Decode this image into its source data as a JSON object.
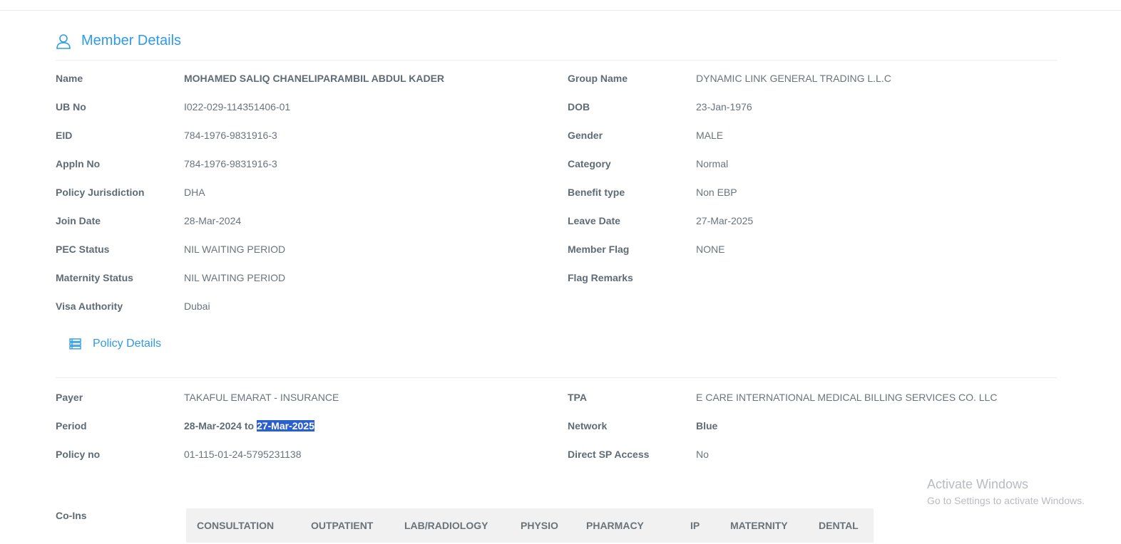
{
  "member": {
    "title": "Member Details",
    "left": [
      {
        "label": "Name",
        "value": "MOHAMED SALIQ CHANELIPARAMBIL ABDUL KADER",
        "bold": true
      },
      {
        "label": "UB No",
        "value": "I022-029-114351406-01"
      },
      {
        "label": "EID",
        "value": "784-1976-9831916-3"
      },
      {
        "label": "Appln No",
        "value": "784-1976-9831916-3"
      },
      {
        "label": "Policy Jurisdiction",
        "value": "DHA"
      },
      {
        "label": "Join Date",
        "value": "28-Mar-2024"
      },
      {
        "label": "PEC Status",
        "value": "NIL WAITING PERIOD"
      },
      {
        "label": "Maternity Status",
        "value": "NIL WAITING PERIOD"
      },
      {
        "label": "Visa Authority",
        "value": "Dubai"
      }
    ],
    "right": [
      {
        "label": "Group Name",
        "value": "DYNAMIC LINK GENERAL TRADING L.L.C"
      },
      {
        "label": "DOB",
        "value": "23-Jan-1976"
      },
      {
        "label": "Gender",
        "value": "MALE"
      },
      {
        "label": "Category",
        "value": "Normal"
      },
      {
        "label": "Benefit type",
        "value": "Non EBP"
      },
      {
        "label": "Leave Date",
        "value": "27-Mar-2025"
      },
      {
        "label": "Member Flag",
        "value": "NONE"
      },
      {
        "label": "Flag Remarks",
        "value": ""
      }
    ]
  },
  "policy": {
    "title": "Policy Details",
    "payer_label": "Payer",
    "payer": "TAKAFUL EMARAT - INSURANCE",
    "period_label": "Period",
    "period_from": "28-Mar-2024",
    "period_to_word": "to",
    "period_to": "27-Mar-2025",
    "policy_no_label": "Policy no",
    "policy_no": "01-115-01-24-5795231138",
    "tpa_label": "TPA",
    "tpa": "E CARE INTERNATIONAL MEDICAL BILLING SERVICES CO. LLC",
    "network_label": "Network",
    "network": "Blue",
    "direct_label": "Direct SP Access",
    "direct": "No"
  },
  "coins": {
    "label": "Co-Ins",
    "columns": [
      "CONSULTATION",
      "OUTPATIENT",
      "LAB/RADIOLOGY",
      "PHYSIO",
      "PHARMACY",
      "IP",
      "MATERNITY",
      "DENTAL"
    ]
  },
  "watermark": {
    "line1": "Activate Windows",
    "line2": "Go to Settings to activate Windows."
  },
  "colors": {
    "accent": "#2e9be6",
    "selection": "#2b5fce"
  }
}
